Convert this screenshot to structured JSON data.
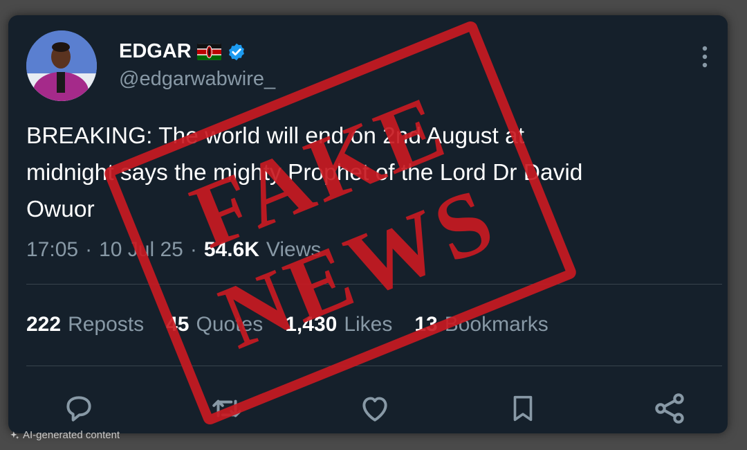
{
  "tweet": {
    "author_name": "EDGAR",
    "handle": "@edgarwabwire_",
    "text_line1": "BREAKING: The world will end on 2nd August at",
    "text_line2": "midnight says the mighty Prophet of the Lord Dr David",
    "text_line3": "Owuor",
    "time": "17:05",
    "separator": "·",
    "date": "10 Jul 25",
    "views_count": "54.6K",
    "views_label": "Views"
  },
  "stats": {
    "reposts_count": "222",
    "reposts_label": "Reposts",
    "quotes_count": "45",
    "quotes_label": "Quotes",
    "likes_count": "1,430",
    "likes_label": "Likes",
    "bookmarks_count": "13",
    "bookmarks_label": "Bookmarks"
  },
  "stamp": {
    "line1": "FAKE",
    "line2": "NEWS"
  },
  "footer": {
    "ai_label": "AI-generated content"
  },
  "icons": {
    "reply": "reply-icon",
    "repost": "repost-icon",
    "like": "heart-icon",
    "bookmark": "bookmark-icon",
    "share": "share-icon",
    "more": "more-vertical-icon",
    "verified": "verified-badge-icon",
    "flag": "kenya-flag-icon"
  },
  "colors": {
    "card_bg": "#15202b",
    "text_primary": "#ffffff",
    "text_secondary": "#8899a6",
    "verified_blue": "#1d9bf0",
    "stamp_red": "#c81a22"
  }
}
